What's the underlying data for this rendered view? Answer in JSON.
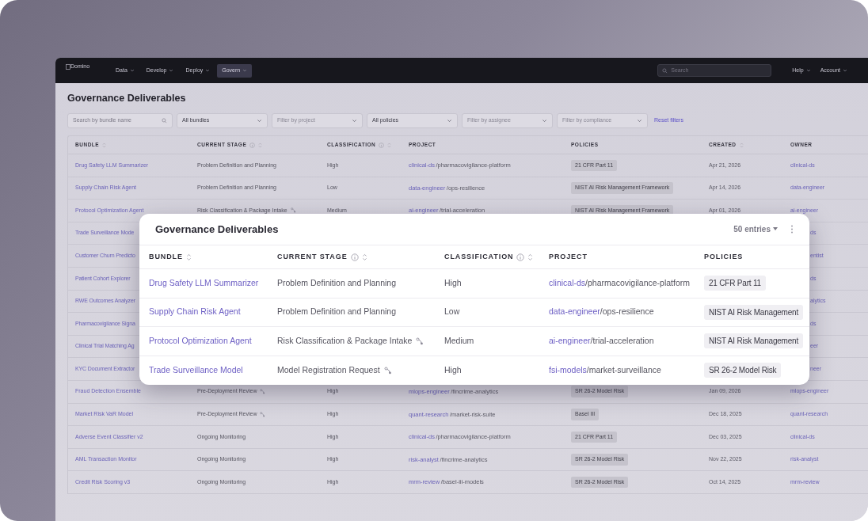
{
  "nav": {
    "logo": "Domino",
    "items": [
      {
        "label": "Data",
        "selected": false
      },
      {
        "label": "Develop",
        "selected": false
      },
      {
        "label": "Deploy",
        "selected": false
      },
      {
        "label": "Govern",
        "selected": true
      }
    ],
    "search": {
      "placeholder": "Search"
    },
    "right": [
      "Help",
      "Account"
    ]
  },
  "page": {
    "title": "Governance Deliverables",
    "filters": [
      {
        "kind": "search",
        "placeholder": "Search by bundle name"
      },
      {
        "kind": "select",
        "value": "All bundles"
      },
      {
        "kind": "select",
        "placeholder": "Filter by project"
      },
      {
        "kind": "select",
        "value": "All policies"
      },
      {
        "kind": "select",
        "placeholder": "Filter by assignee"
      },
      {
        "kind": "select",
        "placeholder": "Filter by compliance"
      }
    ],
    "reset": "Reset filters"
  },
  "table": {
    "columns": [
      {
        "label": "BUNDLE",
        "info": false,
        "sortable": true
      },
      {
        "label": "CURRENT STAGE",
        "info": true,
        "sortable": true
      },
      {
        "label": "CLASSIFICATION",
        "info": true,
        "sortable": true
      },
      {
        "label": "PROJECT",
        "info": false,
        "sortable": false
      },
      {
        "label": "POLICIES",
        "info": false,
        "sortable": false
      },
      {
        "label": "CREATED",
        "info": false,
        "sortable": true
      },
      {
        "label": "OWNER",
        "info": false,
        "sortable": false
      }
    ],
    "rows": [
      {
        "kind": "full",
        "bundle": "Drug Safety LLM Summarizer",
        "stage": "Problem Definition and Planning",
        "handoff": false,
        "classification": "High",
        "project": {
          "link": "clinical-ds",
          "rest": "/pharmacovigilance-platform"
        },
        "policy": "21 CFR Part 11",
        "created": "Apr 21, 2026",
        "owner": "clinical-ds"
      },
      {
        "kind": "full",
        "bundle": "Supply Chain Risk Agent",
        "stage": "Problem Definition and Planning",
        "handoff": false,
        "classification": "Low",
        "project": {
          "link": "data-engineer",
          "rest": "/ops-resilience"
        },
        "policy": "NIST AI Risk Management Framework",
        "created": "Apr 14, 2026",
        "owner": "data-engineer"
      },
      {
        "kind": "full",
        "bundle": "Protocol Optimization Agent",
        "stage": "Risk Classification & Package Intake",
        "handoff": true,
        "classification": "Medium",
        "project": {
          "link": "ai-engineer",
          "rest": "/trial-acceleration"
        },
        "policy": "NIST AI Risk Management Framework",
        "created": "Apr 01, 2026",
        "owner": "ai-engineer"
      },
      {
        "kind": "covered",
        "bundle": "Trade Surveillance Mode",
        "owner": "ds"
      },
      {
        "kind": "covered",
        "bundle": "Customer Churn Predicto",
        "owner": "entist"
      },
      {
        "kind": "covered",
        "bundle": "Patient Cohort Explorer",
        "owner": "ds"
      },
      {
        "kind": "covered",
        "bundle": "RWE Outcomes Analyzer",
        "owner": "alytics"
      },
      {
        "kind": "covered",
        "bundle": "Pharmacovigilance Signa",
        "owner": "ds"
      },
      {
        "kind": "covered",
        "bundle": "Clinical Trial Matching Ag",
        "owner": "eer"
      },
      {
        "kind": "covered",
        "bundle": "KYC Document Extractor",
        "owner": "neer"
      },
      {
        "kind": "full",
        "bundle": "Fraud Detection Ensemble",
        "stage": "Pre-Deployment Review",
        "handoff": true,
        "classification": "High",
        "project": {
          "link": "mlops-engineer",
          "rest": "/fincrime-analytics"
        },
        "policy": "SR 26-2 Model Risk",
        "created": "Jan 09, 2026",
        "owner": "mlops-engineer"
      },
      {
        "kind": "full",
        "bundle": "Market Risk VaR Model",
        "stage": "Pre-Deployment Review",
        "handoff": true,
        "classification": "High",
        "project": {
          "link": "quant-research",
          "rest": "/market-risk-suite"
        },
        "policy": "Basel III",
        "created": "Dec 18, 2025",
        "owner": "quant-research"
      },
      {
        "kind": "full",
        "bundle": "Adverse Event Classifier v2",
        "stage": "Ongoing Monitoring",
        "handoff": false,
        "classification": "High",
        "project": {
          "link": "clinical-ds",
          "rest": "/pharmacovigilance-platform"
        },
        "policy": "21 CFR Part 11",
        "created": "Dec 03, 2025",
        "owner": "clinical-ds"
      },
      {
        "kind": "full",
        "bundle": "AML Transaction Monitor",
        "stage": "Ongoing Monitoring",
        "handoff": false,
        "classification": "High",
        "project": {
          "link": "risk-analyst",
          "rest": "/fincrime-analytics"
        },
        "policy": "SR 26-2 Model Risk",
        "created": "Nov 22, 2025",
        "owner": "risk-analyst"
      },
      {
        "kind": "full",
        "bundle": "Credit Risk Scoring v3",
        "stage": "Ongoing Monitoring",
        "handoff": false,
        "classification": "High",
        "project": {
          "link": "mrm-review",
          "rest": "/basel-iii-models"
        },
        "policy": "SR 26-2 Model Risk",
        "created": "Oct 14, 2025",
        "owner": "mrm-review"
      }
    ]
  },
  "card": {
    "title": "Governance Deliverables",
    "entries": "50 entries",
    "columns": [
      {
        "label": "BUNDLE",
        "info": false,
        "sortable": true
      },
      {
        "label": "CURRENT STAGE",
        "info": true,
        "sortable": true
      },
      {
        "label": "CLASSIFICATION",
        "info": true,
        "sortable": true
      },
      {
        "label": "PROJECT",
        "info": false,
        "sortable": false
      },
      {
        "label": "POLICIES",
        "info": false,
        "sortable": false
      }
    ],
    "rows": [
      {
        "bundle": "Drug Safety LLM Summarizer",
        "stage": "Problem Definition and Planning",
        "handoff": false,
        "classification": "High",
        "project": {
          "link": "clinical-ds",
          "rest": "/pharmacovigilance-platform"
        },
        "policy": "21 CFR Part 11"
      },
      {
        "bundle": "Supply Chain Risk Agent",
        "stage": "Problem Definition and Planning",
        "handoff": false,
        "classification": "Low",
        "project": {
          "link": "data-engineer",
          "rest": "/ops-resilience"
        },
        "policy": "NIST AI Risk Management"
      },
      {
        "bundle": "Protocol Optimization Agent",
        "stage": "Risk Classification & Package Intake",
        "handoff": true,
        "classification": "Medium",
        "project": {
          "link": "ai-engineer",
          "rest": "/trial-acceleration"
        },
        "policy": "NIST AI Risk Management"
      },
      {
        "bundle": "Trade Surveillance Model",
        "stage": "Model Registration Request",
        "handoff": true,
        "classification": "High",
        "project": {
          "link": "fsi-models",
          "rest": "/market-surveillance"
        },
        "policy": "SR 26-2 Model Risk"
      }
    ]
  }
}
